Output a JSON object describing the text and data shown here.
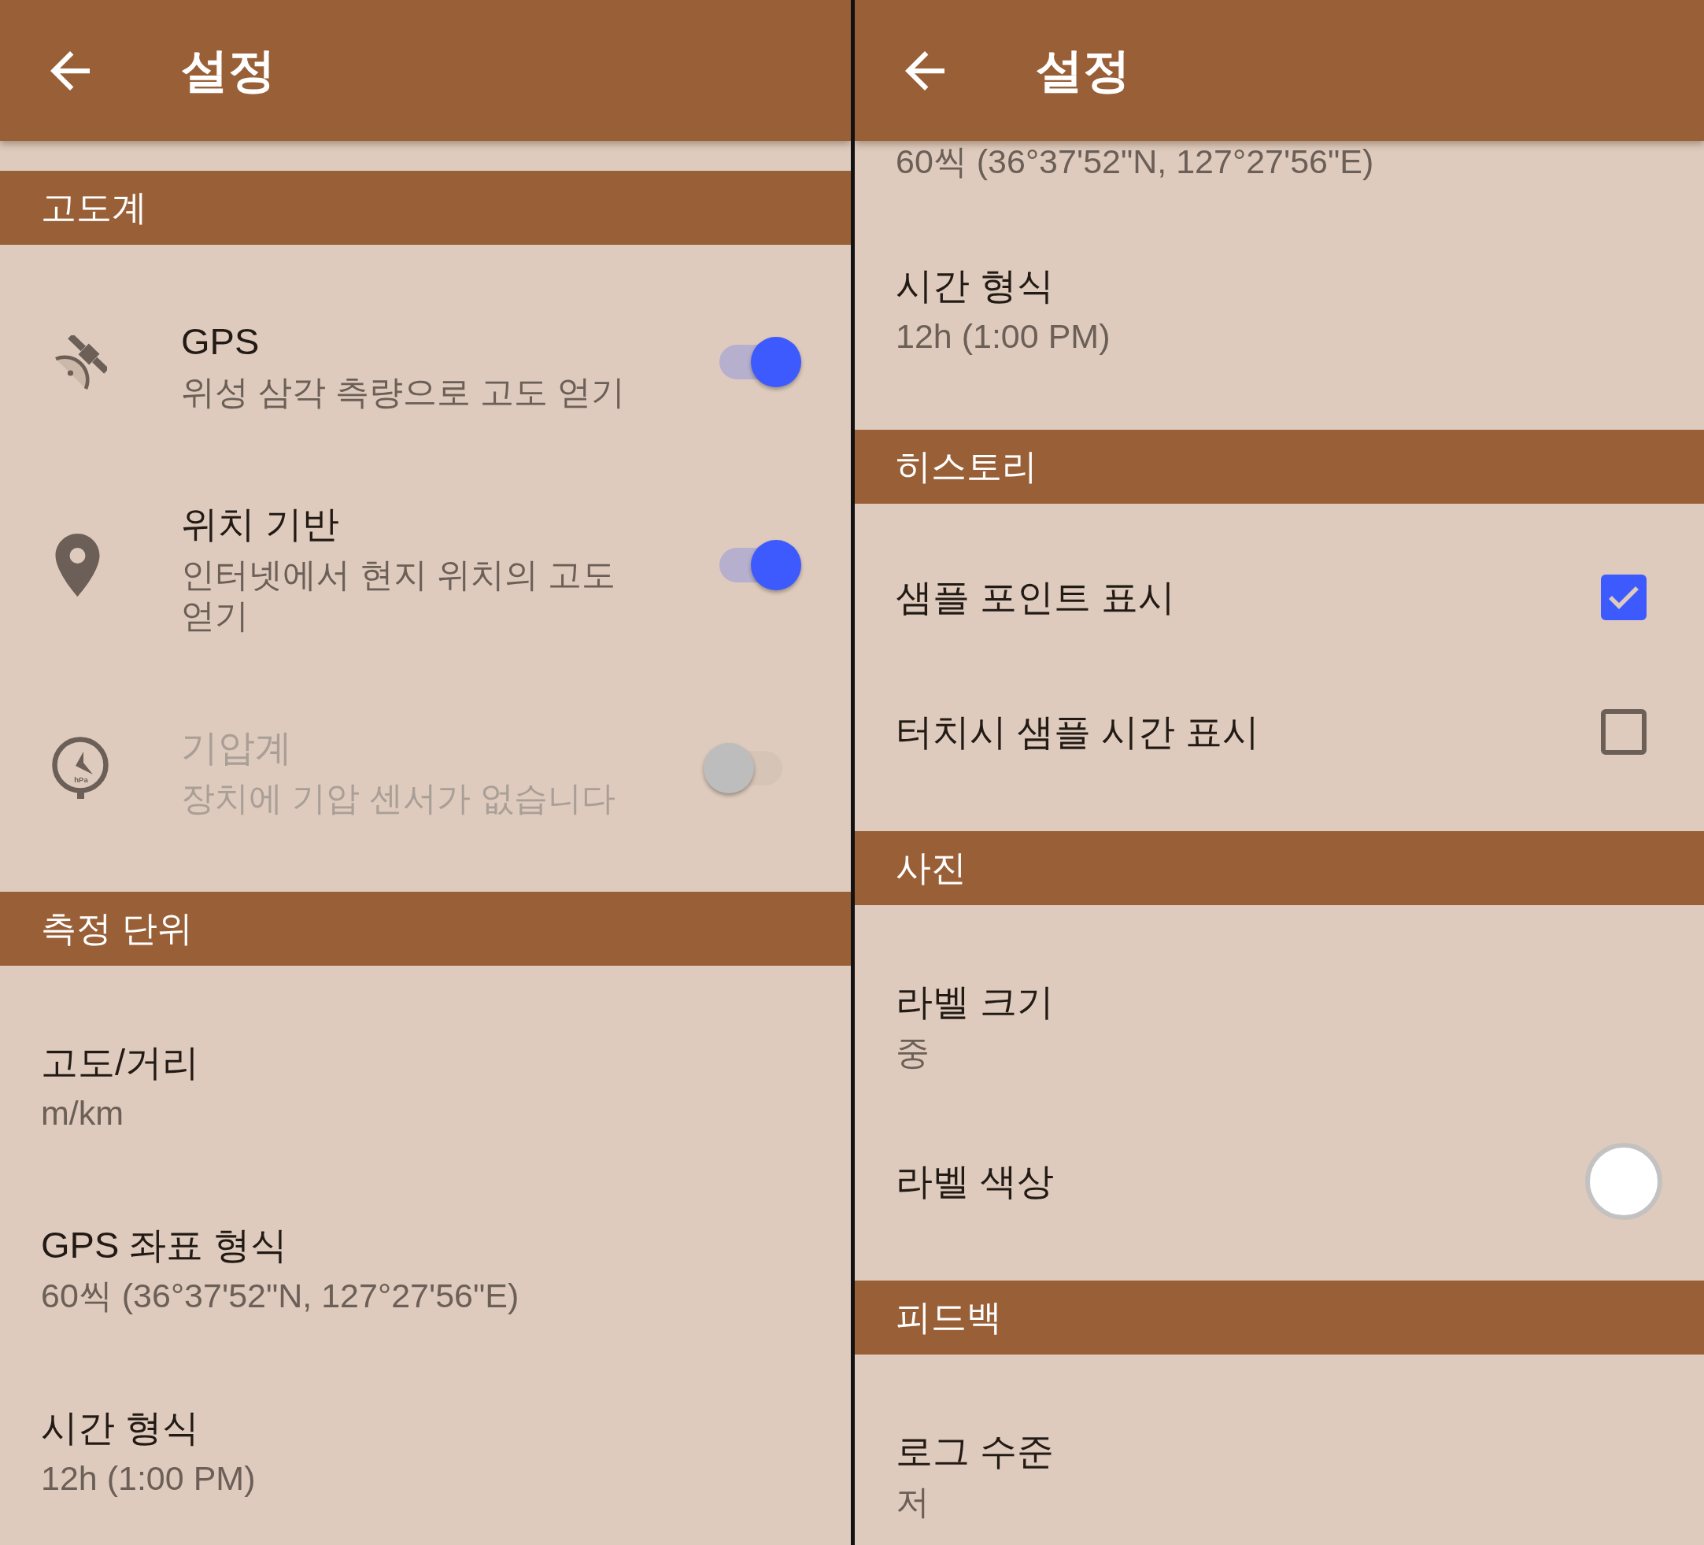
{
  "screens": [
    {
      "app_bar": {
        "title": "설정"
      },
      "sections": [
        {
          "header": "고도계",
          "items": [
            {
              "kind": "switch",
              "title": "GPS",
              "subtitle": "위성 삼각 측량으로 고도 얻기",
              "on": true,
              "disabled": false
            },
            {
              "kind": "switch",
              "title": "위치 기반",
              "subtitle": "인터넷에서 현지 위치의 고도 얻기",
              "on": true,
              "disabled": false
            },
            {
              "kind": "switch",
              "title": "기압계",
              "subtitle": "장치에 기압 센서가 없습니다",
              "on": false,
              "disabled": true,
              "icon_label": "hPa"
            }
          ]
        },
        {
          "header": "측정 단위",
          "items": [
            {
              "kind": "text",
              "title": "고도/거리",
              "subtitle": "m/km"
            },
            {
              "kind": "text",
              "title": "GPS 좌표 형식",
              "subtitle": "60씩 (36°37'52\"N, 127°27'56\"E)"
            },
            {
              "kind": "text",
              "title": "시간 형식",
              "subtitle": "12h (1:00 PM)"
            }
          ]
        }
      ]
    },
    {
      "app_bar": {
        "title": "설정"
      },
      "sections": [
        {
          "items": [
            {
              "kind": "text",
              "subtitle": "60씩 (36°37'52\"N, 127°27'56\"E)"
            },
            {
              "kind": "text",
              "title": "시간 형식",
              "subtitle": "12h (1:00 PM)"
            }
          ]
        },
        {
          "header": "히스토리",
          "items": [
            {
              "kind": "checkbox",
              "title": "샘플 포인트 표시",
              "checked": true
            },
            {
              "kind": "checkbox",
              "title": "터치시 샘플 시간 표시",
              "checked": false
            }
          ]
        },
        {
          "header": "사진",
          "items": [
            {
              "kind": "text",
              "title": "라벨 크기",
              "subtitle": "중"
            },
            {
              "kind": "color",
              "title": "라벨 색상",
              "color": "#ffffff"
            }
          ]
        },
        {
          "header": "피드백",
          "items": [
            {
              "kind": "text",
              "title": "로그 수준",
              "subtitle": "저"
            }
          ]
        }
      ]
    }
  ]
}
